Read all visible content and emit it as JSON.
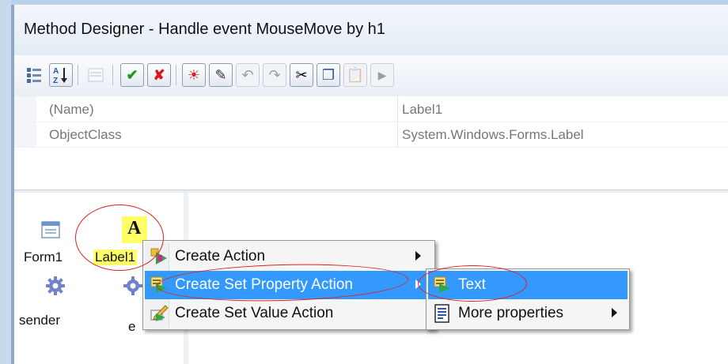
{
  "window": {
    "title": "Method Designer - Handle event MouseMove by h1"
  },
  "toolbar": {
    "buttons": [
      {
        "name": "categorized",
        "icon": "categorized-icon"
      },
      {
        "name": "alphabetical",
        "icon": "sort-az-icon",
        "label": "A Z"
      },
      {
        "name": "property-pages",
        "icon": "property-pages-icon",
        "disabled": true
      },
      {
        "name": "ok",
        "icon": "check-icon",
        "label": "✔"
      },
      {
        "name": "cancel",
        "icon": "cross-icon",
        "label": "✘"
      },
      {
        "name": "debug",
        "icon": "bug-icon",
        "label": "☀"
      },
      {
        "name": "tools",
        "icon": "wand-icon",
        "label": "✎"
      },
      {
        "name": "undo",
        "icon": "undo-icon",
        "label": "↶",
        "disabled": true
      },
      {
        "name": "redo",
        "icon": "redo-icon",
        "label": "↷",
        "disabled": true
      },
      {
        "name": "cut",
        "icon": "scissors-icon",
        "label": "✂"
      },
      {
        "name": "copy",
        "icon": "copy-icon",
        "label": "❐"
      },
      {
        "name": "paste",
        "icon": "paste-icon",
        "label": "📋",
        "disabled": true
      },
      {
        "name": "run",
        "icon": "play-icon",
        "label": "▶",
        "disabled": true
      }
    ]
  },
  "properties": {
    "rows": [
      {
        "name": "(Name)",
        "value": "Label1"
      },
      {
        "name": "ObjectClass",
        "value": "System.Windows.Forms.Label"
      }
    ]
  },
  "canvas": {
    "nodes": {
      "form1": "Form1",
      "label1": "Label1",
      "label1_glyph": "A",
      "sender": "sender",
      "e": "e"
    }
  },
  "context_menu": {
    "items": [
      {
        "label": "Create Action",
        "has_submenu": true,
        "icon": "create-action-icon"
      },
      {
        "label": "Create Set Property Action",
        "has_submenu": true,
        "selected": true,
        "icon": "set-property-icon"
      },
      {
        "label": "Create Set Value Action",
        "has_submenu": false,
        "icon": "set-value-icon"
      }
    ]
  },
  "submenu": {
    "items": [
      {
        "label": "Text",
        "selected": true,
        "icon": "property-text-icon"
      },
      {
        "label": "More properties",
        "has_submenu": true,
        "icon": "more-properties-icon"
      }
    ]
  },
  "colors": {
    "selection": "#3399ff",
    "highlight": "#ffff66",
    "annotation": "#e02020"
  }
}
